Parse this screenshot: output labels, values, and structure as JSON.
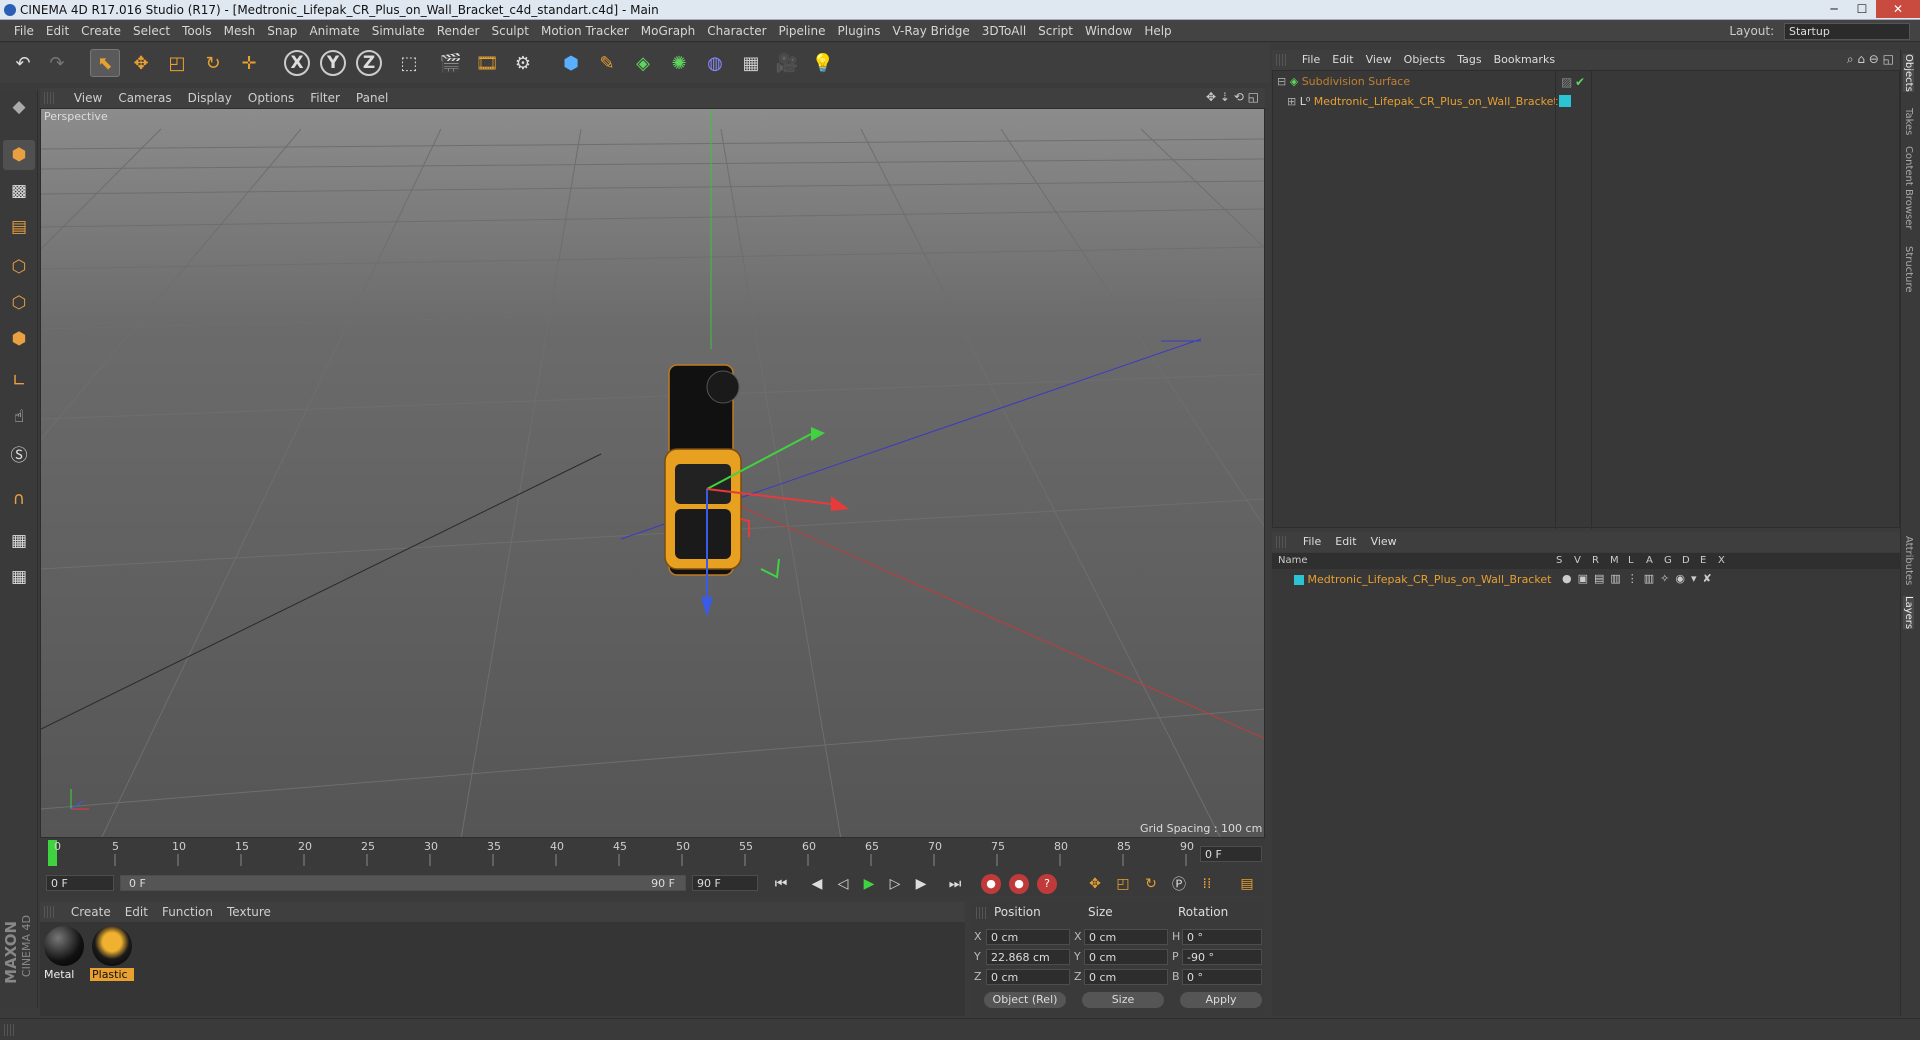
{
  "window": {
    "title": "CINEMA 4D R17.016 Studio (R17) - [Medtronic_Lifepak_CR_Plus_on_Wall_Bracket_c4d_standart.c4d] - Main",
    "min": "─",
    "max": "☐",
    "close": "✕"
  },
  "menubar": {
    "items": [
      "File",
      "Edit",
      "Create",
      "Select",
      "Tools",
      "Mesh",
      "Snap",
      "Animate",
      "Simulate",
      "Render",
      "Sculpt",
      "Motion Tracker",
      "MoGraph",
      "Character",
      "Pipeline",
      "Plugins",
      "V-Ray Bridge",
      "3DToAll",
      "Script",
      "Window",
      "Help"
    ],
    "layout_label": "Layout:",
    "layout_value": "Startup"
  },
  "toolbar": {
    "x_label": "X",
    "y_label": "Y",
    "z_label": "Z"
  },
  "viewport": {
    "menu": [
      "View",
      "Cameras",
      "Display",
      "Options",
      "Filter",
      "Panel"
    ],
    "camera_label": "Perspective",
    "grid_spacing": "Grid Spacing : 100 cm"
  },
  "timeline": {
    "ticks": [
      "0",
      "5",
      "10",
      "15",
      "20",
      "25",
      "30",
      "35",
      "40",
      "45",
      "50",
      "55",
      "60",
      "65",
      "70",
      "75",
      "80",
      "85",
      "90"
    ],
    "current_frame": "0 F",
    "start_field": "0 F",
    "range_start": "0 F",
    "range_end": "90 F",
    "end_field": "90 F"
  },
  "materials": {
    "menu": [
      "Create",
      "Edit",
      "Function",
      "Texture"
    ],
    "items": [
      {
        "name": "Metal"
      },
      {
        "name": "Plastic"
      }
    ]
  },
  "coords": {
    "headers": {
      "position": "Position",
      "size": "Size",
      "rotation": "Rotation"
    },
    "rows": [
      {
        "axis": "X",
        "pos": "0 cm",
        "size_axis": "X",
        "size": "0 cm",
        "rot_axis": "H",
        "rot": "0 °"
      },
      {
        "axis": "Y",
        "pos": "22.868 cm",
        "size_axis": "Y",
        "size": "0 cm",
        "rot_axis": "P",
        "rot": "-90 °"
      },
      {
        "axis": "Z",
        "pos": "0 cm",
        "size_axis": "Z",
        "size": "0 cm",
        "rot_axis": "B",
        "rot": "0 °"
      }
    ],
    "mode": "Object (Rel)",
    "size_mode": "Size",
    "apply": "Apply"
  },
  "object_manager": {
    "menu": [
      "File",
      "Edit",
      "View",
      "Objects",
      "Tags",
      "Bookmarks"
    ],
    "objects": [
      {
        "name": "Subdivision Surface"
      },
      {
        "name": "Medtronic_Lifepak_CR_Plus_on_Wall_Bracket"
      }
    ]
  },
  "layer_manager": {
    "menu": [
      "File",
      "Edit",
      "View"
    ],
    "header_name": "Name",
    "flags": [
      "S",
      "V",
      "R",
      "M",
      "L",
      "A",
      "G",
      "D",
      "E",
      "X"
    ],
    "layers": [
      {
        "name": "Medtronic_Lifepak_CR_Plus_on_Wall_Bracket"
      }
    ]
  },
  "side_tabs": [
    "Objects",
    "Takes",
    "Content Browser",
    "Structure",
    "Attributes",
    "Layers"
  ],
  "branding": {
    "maxon": "MAXON",
    "product": "CINEMA 4D"
  },
  "colors": {
    "accent": "#e8a030",
    "layer_color": "#2bc4d4"
  }
}
